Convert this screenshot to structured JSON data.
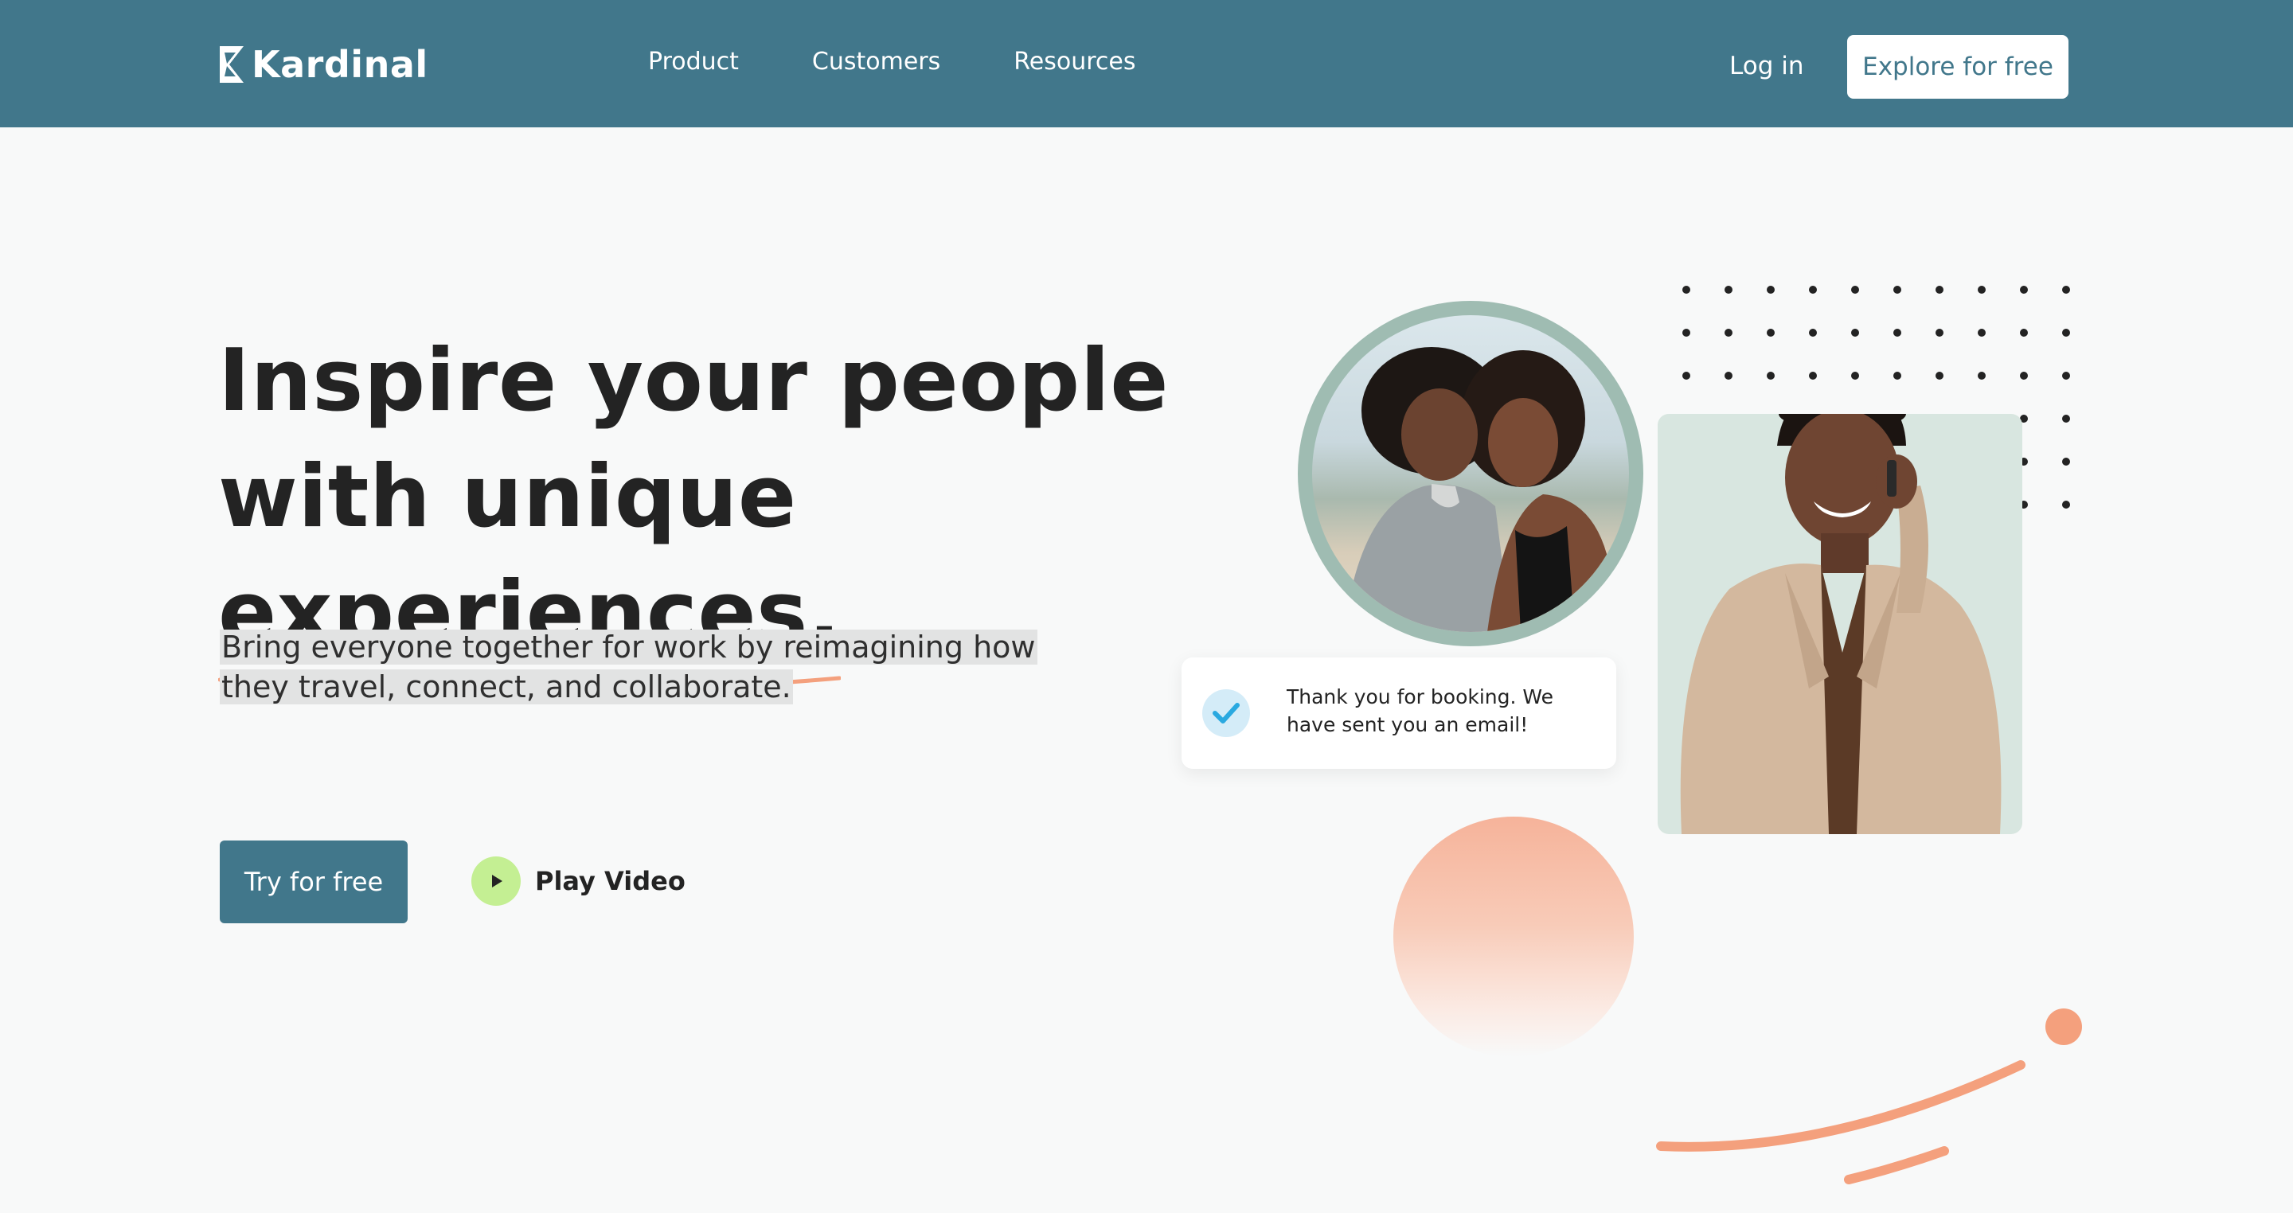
{
  "brand": {
    "name": "Kardinal",
    "logo_icon": "kardinal-logo-mark"
  },
  "nav": {
    "links": [
      "Product",
      "Customers",
      "Resources"
    ],
    "login_label": "Log in",
    "cta_label": "Explore for free"
  },
  "hero": {
    "headline_part1": "Inspire your people with unique",
    "headline_highlight": "experiences.",
    "subtext": "Bring everyone together for work by reimagining how they travel, connect, and collaborate.",
    "primary_cta": "Try for free",
    "video_cta": "Play Video"
  },
  "notification": {
    "icon": "checkmark-icon",
    "text": "Thank you for booking. We have sent you an email!"
  },
  "colors": {
    "brand_teal": "#41778b",
    "accent_peach": "#f4a07d",
    "play_green": "#c4ef93",
    "check_blue": "#2aa9e0",
    "background": "#f8f9f9"
  }
}
